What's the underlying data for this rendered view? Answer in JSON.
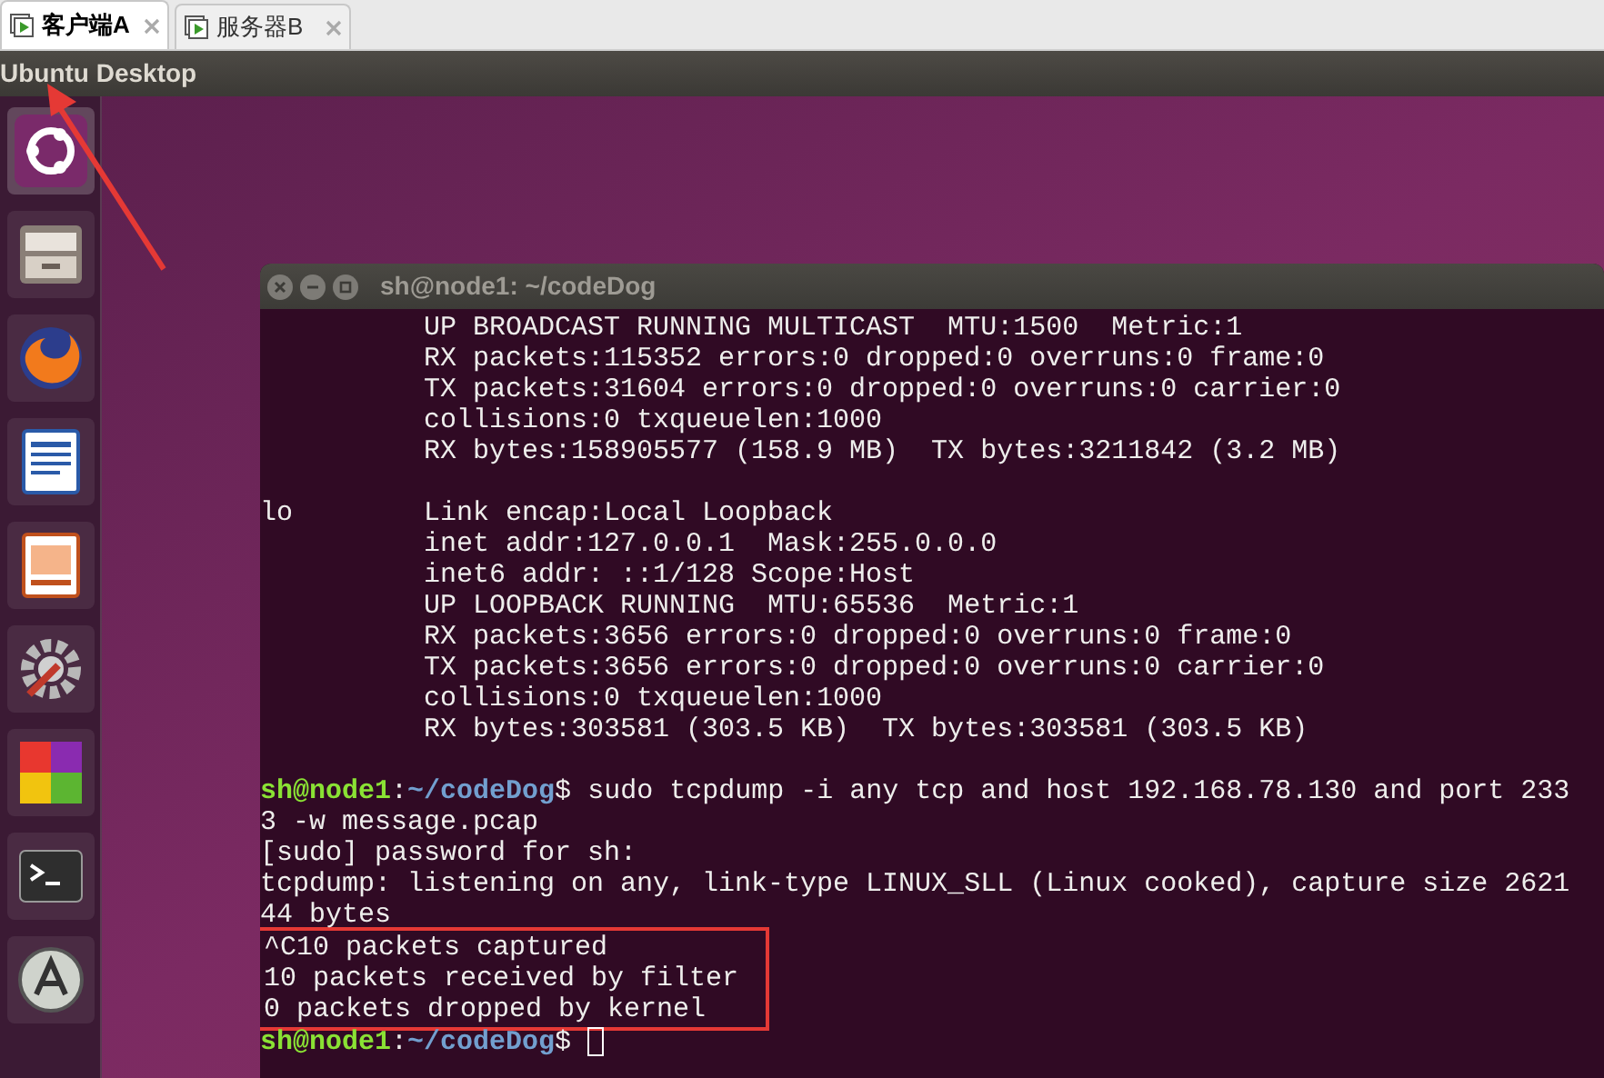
{
  "tabs": [
    {
      "label": "客户端A",
      "selected": true
    },
    {
      "label": "服务器B",
      "selected": false
    }
  ],
  "vm_title": "Ubuntu Desktop",
  "launcher": [
    {
      "kind": "dash",
      "selected": true
    },
    {
      "kind": "files",
      "selected": false
    },
    {
      "kind": "browser",
      "selected": false
    },
    {
      "kind": "writer",
      "selected": false
    },
    {
      "kind": "impress",
      "selected": false
    },
    {
      "kind": "settings",
      "selected": false
    },
    {
      "kind": "grid",
      "selected": false
    },
    {
      "kind": "terminal",
      "selected": false
    },
    {
      "kind": "updater",
      "selected": false
    }
  ],
  "terminal": {
    "title": "sh@node1: ~/codeDog",
    "lines": [
      {
        "kind": "output",
        "text": "          UP BROADCAST RUNNING MULTICAST  MTU:1500  Metric:1"
      },
      {
        "kind": "output",
        "text": "          RX packets:115352 errors:0 dropped:0 overruns:0 frame:0"
      },
      {
        "kind": "output",
        "text": "          TX packets:31604 errors:0 dropped:0 overruns:0 carrier:0"
      },
      {
        "kind": "output",
        "text": "          collisions:0 txqueuelen:1000"
      },
      {
        "kind": "output",
        "text": "          RX bytes:158905577 (158.9 MB)  TX bytes:3211842 (3.2 MB)"
      },
      {
        "kind": "blank"
      },
      {
        "kind": "output",
        "text": "lo        Link encap:Local Loopback"
      },
      {
        "kind": "output",
        "text": "          inet addr:127.0.0.1  Mask:255.0.0.0"
      },
      {
        "kind": "output",
        "text": "          inet6 addr: ::1/128 Scope:Host"
      },
      {
        "kind": "output",
        "text": "          UP LOOPBACK RUNNING  MTU:65536  Metric:1"
      },
      {
        "kind": "output",
        "text": "          RX packets:3656 errors:0 dropped:0 overruns:0 frame:0"
      },
      {
        "kind": "output",
        "text": "          TX packets:3656 errors:0 dropped:0 overruns:0 carrier:0"
      },
      {
        "kind": "output",
        "text": "          collisions:0 txqueuelen:1000"
      },
      {
        "kind": "output",
        "text": "          RX bytes:303581 (303.5 KB)  TX bytes:303581 (303.5 KB)"
      },
      {
        "kind": "blank"
      },
      {
        "kind": "prompt",
        "user": "sh@node1",
        "sep": ":",
        "path": "~/codeDog",
        "symbol": "$",
        "command": "sudo tcpdump -i any tcp and host 192.168.78.130 and port 233",
        "cursor": false
      },
      {
        "kind": "output",
        "text": "3 -w message.pcap"
      },
      {
        "kind": "output",
        "text": "[sudo] password for sh:"
      },
      {
        "kind": "output",
        "text": "tcpdump: listening on any, link-type LINUX_SLL (Linux cooked), capture size 2621"
      },
      {
        "kind": "output",
        "text": "44 bytes"
      },
      {
        "kind": "highlight",
        "lines": [
          "^C10 packets captured",
          "10 packets received by filter",
          "0 packets dropped by kernel"
        ]
      },
      {
        "kind": "prompt",
        "user": "sh@node1",
        "sep": ":",
        "path": "~/codeDog",
        "symbol": "$",
        "cursor": true
      }
    ]
  }
}
